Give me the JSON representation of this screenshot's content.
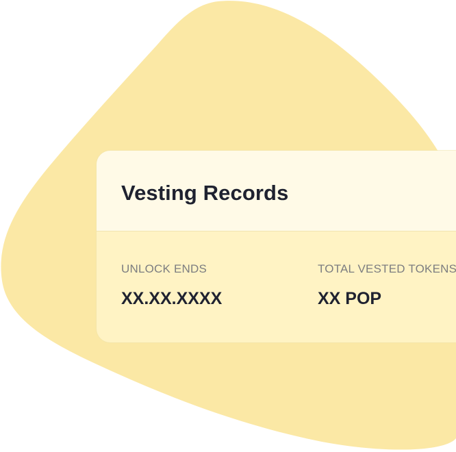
{
  "card": {
    "title": "Vesting Records"
  },
  "fields": {
    "unlock_ends": {
      "label": "UNLOCK ENDS",
      "value": "XX.XX.XXXX"
    },
    "total_vested": {
      "label": "TOTAL VESTED TOKENS",
      "value": "XX POP"
    }
  },
  "colors": {
    "blob": "#fbe8a5",
    "card_body": "#fff3c4",
    "card_header": "#fffae7",
    "text_dark": "#1f2230",
    "text_muted": "#7c7d80"
  }
}
